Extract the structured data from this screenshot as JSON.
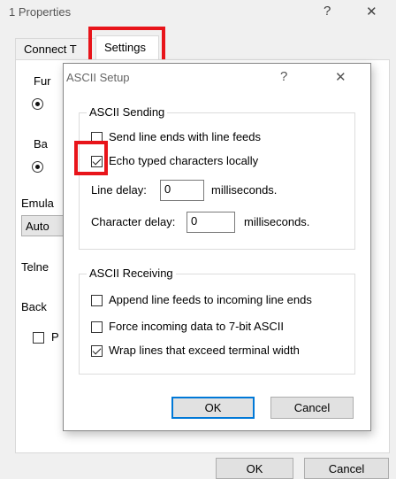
{
  "props": {
    "title": "1 Properties",
    "help_icon": "?",
    "close_icon": "✕",
    "tabs": [
      {
        "label": "Connect T"
      },
      {
        "label": "Settings"
      }
    ],
    "bg_labels": [
      "Fur",
      "Ba",
      "Emula",
      "Auto",
      "Telne",
      "Back"
    ],
    "bg_checkbox_label": "P",
    "ok_label": "OK",
    "cancel_label": "Cancel"
  },
  "ascii": {
    "title": "ASCII Setup",
    "help_icon": "?",
    "close_icon": "✕",
    "sending": {
      "label": "ASCII Sending",
      "send_line_ends": {
        "label": "Send line ends with line feeds",
        "checked": false
      },
      "echo": {
        "label": "Echo typed characters locally",
        "checked": true
      },
      "line_delay": {
        "label": "Line delay:",
        "value": "0",
        "unit": "milliseconds."
      },
      "char_delay": {
        "label": "Character delay:",
        "value": "0",
        "unit": "milliseconds."
      }
    },
    "receiving": {
      "label": "ASCII Receiving",
      "append": {
        "label": "Append line feeds to incoming line ends",
        "checked": false
      },
      "force7bit": {
        "label": "Force incoming data to 7-bit ASCII",
        "checked": false
      },
      "wrap": {
        "label": "Wrap lines that exceed terminal width",
        "checked": true
      }
    },
    "ok_label": "OK",
    "cancel_label": "Cancel"
  },
  "highlight_color": "#e8141a"
}
